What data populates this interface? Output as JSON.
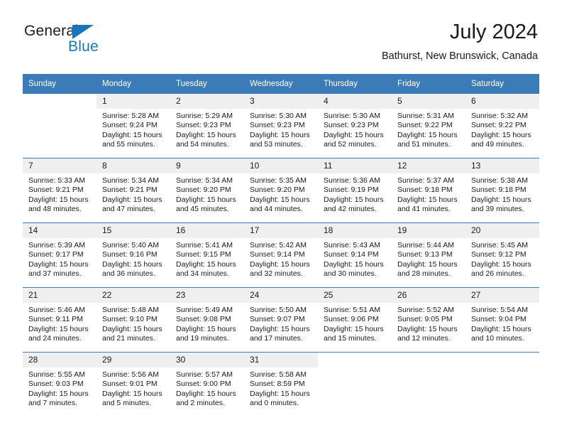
{
  "brand": {
    "name_part1": "General",
    "name_part2": "Blue",
    "accent_color": "#1b75bb"
  },
  "header": {
    "month_title": "July 2024",
    "location": "Bathurst, New Brunswick, Canada",
    "header_bg_color": "#3b7cb8",
    "daynum_bg_color": "#efefef"
  },
  "weekdays": [
    "Sunday",
    "Monday",
    "Tuesday",
    "Wednesday",
    "Thursday",
    "Friday",
    "Saturday"
  ],
  "labels": {
    "sunrise_prefix": "Sunrise:",
    "sunset_prefix": "Sunset:",
    "daylight_prefix": "Daylight:"
  },
  "weeks": [
    [
      {
        "blank": true
      },
      {
        "day": "1",
        "sunrise": "Sunrise: 5:28 AM",
        "sunset": "Sunset: 9:24 PM",
        "daylight_line1": "Daylight: 15 hours",
        "daylight_line2": "and 55 minutes."
      },
      {
        "day": "2",
        "sunrise": "Sunrise: 5:29 AM",
        "sunset": "Sunset: 9:23 PM",
        "daylight_line1": "Daylight: 15 hours",
        "daylight_line2": "and 54 minutes."
      },
      {
        "day": "3",
        "sunrise": "Sunrise: 5:30 AM",
        "sunset": "Sunset: 9:23 PM",
        "daylight_line1": "Daylight: 15 hours",
        "daylight_line2": "and 53 minutes."
      },
      {
        "day": "4",
        "sunrise": "Sunrise: 5:30 AM",
        "sunset": "Sunset: 9:23 PM",
        "daylight_line1": "Daylight: 15 hours",
        "daylight_line2": "and 52 minutes."
      },
      {
        "day": "5",
        "sunrise": "Sunrise: 5:31 AM",
        "sunset": "Sunset: 9:22 PM",
        "daylight_line1": "Daylight: 15 hours",
        "daylight_line2": "and 51 minutes."
      },
      {
        "day": "6",
        "sunrise": "Sunrise: 5:32 AM",
        "sunset": "Sunset: 9:22 PM",
        "daylight_line1": "Daylight: 15 hours",
        "daylight_line2": "and 49 minutes."
      }
    ],
    [
      {
        "day": "7",
        "sunrise": "Sunrise: 5:33 AM",
        "sunset": "Sunset: 9:21 PM",
        "daylight_line1": "Daylight: 15 hours",
        "daylight_line2": "and 48 minutes."
      },
      {
        "day": "8",
        "sunrise": "Sunrise: 5:34 AM",
        "sunset": "Sunset: 9:21 PM",
        "daylight_line1": "Daylight: 15 hours",
        "daylight_line2": "and 47 minutes."
      },
      {
        "day": "9",
        "sunrise": "Sunrise: 5:34 AM",
        "sunset": "Sunset: 9:20 PM",
        "daylight_line1": "Daylight: 15 hours",
        "daylight_line2": "and 45 minutes."
      },
      {
        "day": "10",
        "sunrise": "Sunrise: 5:35 AM",
        "sunset": "Sunset: 9:20 PM",
        "daylight_line1": "Daylight: 15 hours",
        "daylight_line2": "and 44 minutes."
      },
      {
        "day": "11",
        "sunrise": "Sunrise: 5:36 AM",
        "sunset": "Sunset: 9:19 PM",
        "daylight_line1": "Daylight: 15 hours",
        "daylight_line2": "and 42 minutes."
      },
      {
        "day": "12",
        "sunrise": "Sunrise: 5:37 AM",
        "sunset": "Sunset: 9:18 PM",
        "daylight_line1": "Daylight: 15 hours",
        "daylight_line2": "and 41 minutes."
      },
      {
        "day": "13",
        "sunrise": "Sunrise: 5:38 AM",
        "sunset": "Sunset: 9:18 PM",
        "daylight_line1": "Daylight: 15 hours",
        "daylight_line2": "and 39 minutes."
      }
    ],
    [
      {
        "day": "14",
        "sunrise": "Sunrise: 5:39 AM",
        "sunset": "Sunset: 9:17 PM",
        "daylight_line1": "Daylight: 15 hours",
        "daylight_line2": "and 37 minutes."
      },
      {
        "day": "15",
        "sunrise": "Sunrise: 5:40 AM",
        "sunset": "Sunset: 9:16 PM",
        "daylight_line1": "Daylight: 15 hours",
        "daylight_line2": "and 36 minutes."
      },
      {
        "day": "16",
        "sunrise": "Sunrise: 5:41 AM",
        "sunset": "Sunset: 9:15 PM",
        "daylight_line1": "Daylight: 15 hours",
        "daylight_line2": "and 34 minutes."
      },
      {
        "day": "17",
        "sunrise": "Sunrise: 5:42 AM",
        "sunset": "Sunset: 9:14 PM",
        "daylight_line1": "Daylight: 15 hours",
        "daylight_line2": "and 32 minutes."
      },
      {
        "day": "18",
        "sunrise": "Sunrise: 5:43 AM",
        "sunset": "Sunset: 9:14 PM",
        "daylight_line1": "Daylight: 15 hours",
        "daylight_line2": "and 30 minutes."
      },
      {
        "day": "19",
        "sunrise": "Sunrise: 5:44 AM",
        "sunset": "Sunset: 9:13 PM",
        "daylight_line1": "Daylight: 15 hours",
        "daylight_line2": "and 28 minutes."
      },
      {
        "day": "20",
        "sunrise": "Sunrise: 5:45 AM",
        "sunset": "Sunset: 9:12 PM",
        "daylight_line1": "Daylight: 15 hours",
        "daylight_line2": "and 26 minutes."
      }
    ],
    [
      {
        "day": "21",
        "sunrise": "Sunrise: 5:46 AM",
        "sunset": "Sunset: 9:11 PM",
        "daylight_line1": "Daylight: 15 hours",
        "daylight_line2": "and 24 minutes."
      },
      {
        "day": "22",
        "sunrise": "Sunrise: 5:48 AM",
        "sunset": "Sunset: 9:10 PM",
        "daylight_line1": "Daylight: 15 hours",
        "daylight_line2": "and 21 minutes."
      },
      {
        "day": "23",
        "sunrise": "Sunrise: 5:49 AM",
        "sunset": "Sunset: 9:08 PM",
        "daylight_line1": "Daylight: 15 hours",
        "daylight_line2": "and 19 minutes."
      },
      {
        "day": "24",
        "sunrise": "Sunrise: 5:50 AM",
        "sunset": "Sunset: 9:07 PM",
        "daylight_line1": "Daylight: 15 hours",
        "daylight_line2": "and 17 minutes."
      },
      {
        "day": "25",
        "sunrise": "Sunrise: 5:51 AM",
        "sunset": "Sunset: 9:06 PM",
        "daylight_line1": "Daylight: 15 hours",
        "daylight_line2": "and 15 minutes."
      },
      {
        "day": "26",
        "sunrise": "Sunrise: 5:52 AM",
        "sunset": "Sunset: 9:05 PM",
        "daylight_line1": "Daylight: 15 hours",
        "daylight_line2": "and 12 minutes."
      },
      {
        "day": "27",
        "sunrise": "Sunrise: 5:54 AM",
        "sunset": "Sunset: 9:04 PM",
        "daylight_line1": "Daylight: 15 hours",
        "daylight_line2": "and 10 minutes."
      }
    ],
    [
      {
        "day": "28",
        "sunrise": "Sunrise: 5:55 AM",
        "sunset": "Sunset: 9:03 PM",
        "daylight_line1": "Daylight: 15 hours",
        "daylight_line2": "and 7 minutes."
      },
      {
        "day": "29",
        "sunrise": "Sunrise: 5:56 AM",
        "sunset": "Sunset: 9:01 PM",
        "daylight_line1": "Daylight: 15 hours",
        "daylight_line2": "and 5 minutes."
      },
      {
        "day": "30",
        "sunrise": "Sunrise: 5:57 AM",
        "sunset": "Sunset: 9:00 PM",
        "daylight_line1": "Daylight: 15 hours",
        "daylight_line2": "and 2 minutes."
      },
      {
        "day": "31",
        "sunrise": "Sunrise: 5:58 AM",
        "sunset": "Sunset: 8:59 PM",
        "daylight_line1": "Daylight: 15 hours",
        "daylight_line2": "and 0 minutes."
      },
      {
        "blank": true
      },
      {
        "blank": true
      },
      {
        "blank": true
      }
    ]
  ]
}
